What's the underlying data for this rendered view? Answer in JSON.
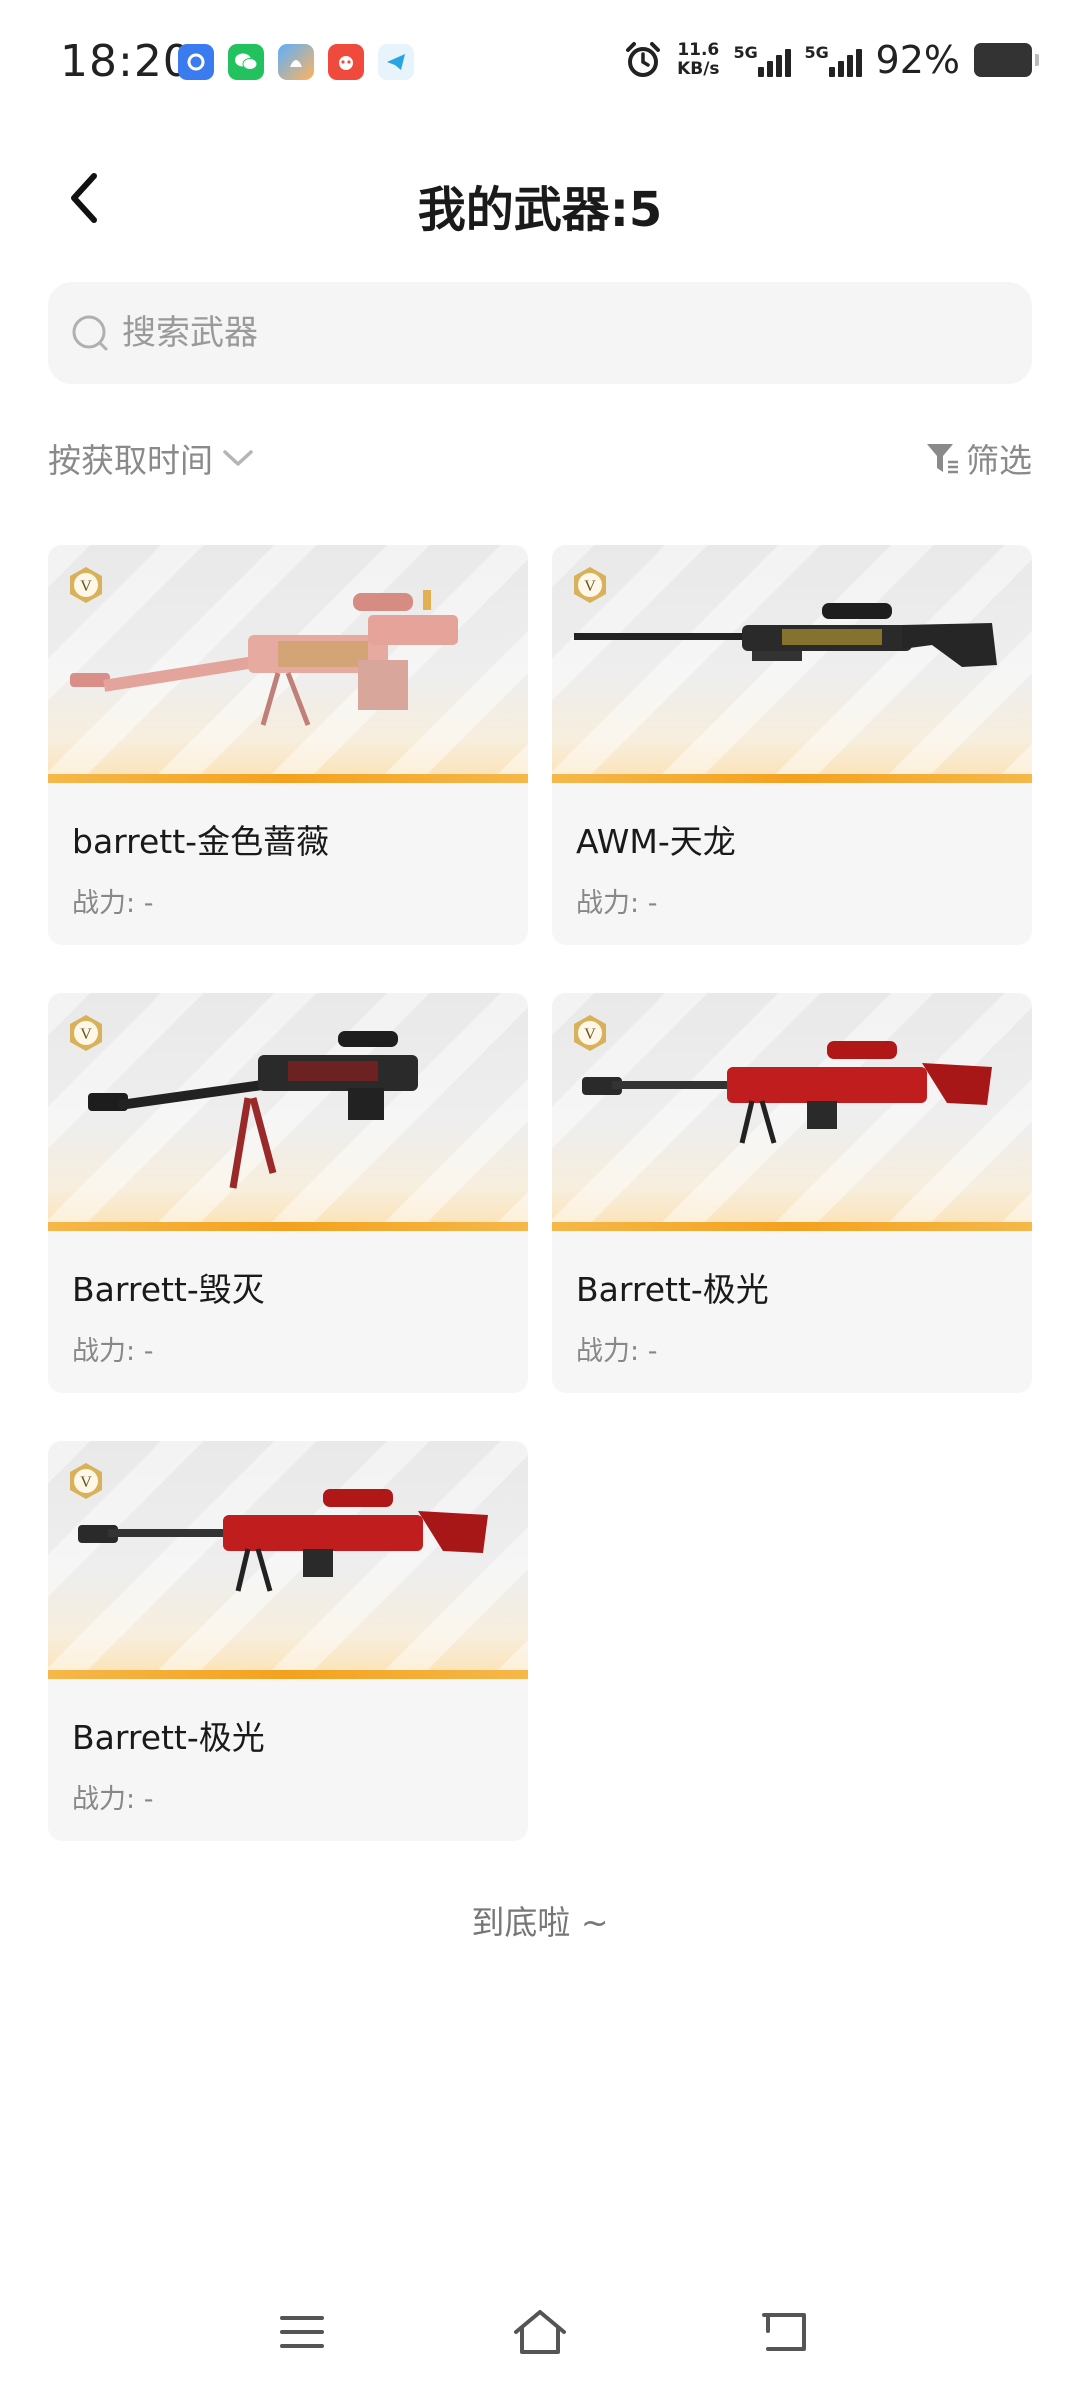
{
  "status_bar": {
    "time": "18:20",
    "net_speed_value": "11.6",
    "net_speed_unit": "KB/s",
    "sim1_label": "5G",
    "sim2_label": "5G",
    "battery_percent": "92%",
    "app_icons": [
      "app-icon-blue",
      "wechat-icon",
      "app-icon-gradient",
      "app-icon-red",
      "telegram-icon"
    ]
  },
  "header": {
    "title": "我的武器:5"
  },
  "search": {
    "placeholder": "搜索武器"
  },
  "toolbar": {
    "sort_label": "按获取时间",
    "filter_label": "筛选"
  },
  "weapons": [
    {
      "name": "barrett-金色蔷薇",
      "power_label": "战力:",
      "power_value": "-",
      "badge": "V",
      "theme": "pink-gold"
    },
    {
      "name": "AWM-天龙",
      "power_label": "战力:",
      "power_value": "-",
      "badge": "V",
      "theme": "black-gold"
    },
    {
      "name": "Barrett-毁灭",
      "power_label": "战力:",
      "power_value": "-",
      "badge": "V",
      "theme": "black-red"
    },
    {
      "name": "Barrett-极光",
      "power_label": "战力:",
      "power_value": "-",
      "badge": "V",
      "theme": "red"
    },
    {
      "name": "Barrett-极光",
      "power_label": "战力:",
      "power_value": "-",
      "badge": "V",
      "theme": "red"
    }
  ],
  "footer": {
    "end_text": "到底啦 ~"
  },
  "colors": {
    "accent_orange": "#f3a21f",
    "card_bg": "#f6f6f6",
    "search_bg": "#f5f5f5"
  }
}
